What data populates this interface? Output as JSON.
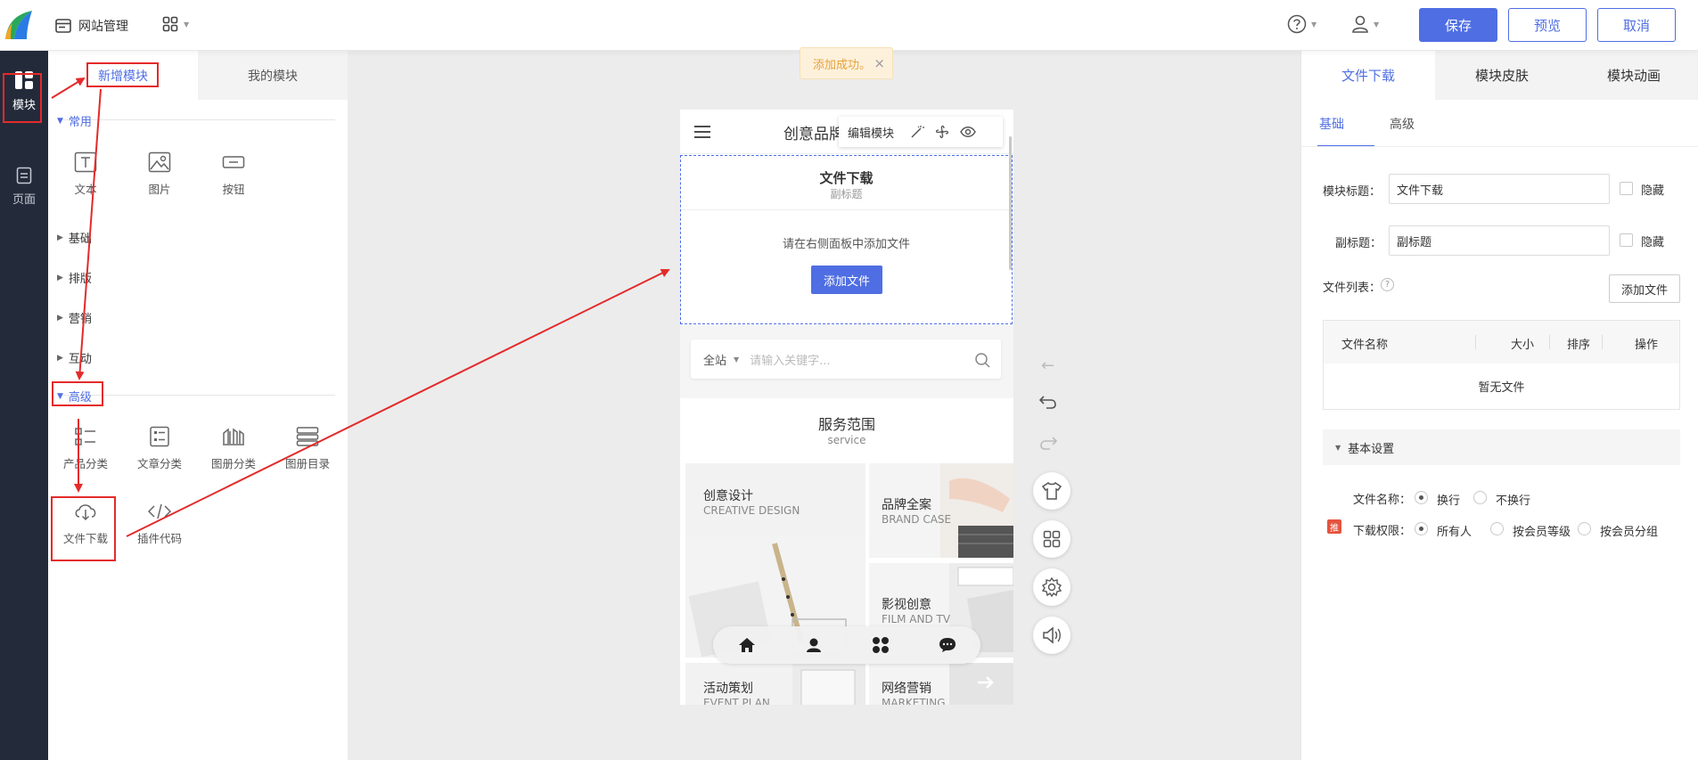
{
  "header": {
    "site_manage": "网站管理",
    "save": "保存",
    "preview": "预览",
    "cancel": "取消"
  },
  "leftnav": {
    "module": "模块",
    "page": "页面"
  },
  "module_panel": {
    "tab_new": "新增模块",
    "tab_mine": "我的模块",
    "group_common": "常用",
    "common_items": [
      "文本",
      "图片",
      "按钮"
    ],
    "group_basic": "基础",
    "group_layout": "排版",
    "group_marketing": "营销",
    "group_interact": "互动",
    "group_advanced": "高级",
    "advanced_items": [
      "产品分类",
      "文章分类",
      "图册分类",
      "图册目录",
      "文件下载",
      "插件代码"
    ]
  },
  "toast": {
    "text": "添加成功。",
    "close": "×"
  },
  "phone": {
    "header_title": "创意品牌",
    "edit_module": "编辑模块",
    "file_module_title": "文件下载",
    "file_module_subtitle": "副标题",
    "empty_hint": "请在右侧面板中添加文件",
    "add_file_btn": "添加文件",
    "search_scope": "全站",
    "search_placeholder": "请输入关键字...",
    "service_title": "服务范围",
    "service_subtitle": "service",
    "services": [
      {
        "cn": "创意设计",
        "en": "CREATIVE DESIGN"
      },
      {
        "cn": "品牌全案",
        "en": "BRAND CASE"
      },
      {
        "cn": "影视创意",
        "en": "FILM AND TV"
      },
      {
        "cn": "活动策划",
        "en": "EVENT PLAN"
      },
      {
        "cn": "网络营销",
        "en": "MARKETING"
      }
    ]
  },
  "right_panel": {
    "tabs": [
      "文件下载",
      "模块皮肤",
      "模块动画"
    ],
    "subtabs": [
      "基础",
      "高级"
    ],
    "title_label": "模块标题：",
    "title_value": "文件下载",
    "hide": "隐藏",
    "subtitle_label": "副标题：",
    "subtitle_value": "副标题",
    "file_list_label": "文件列表：",
    "add_file": "添加文件",
    "table_headers": [
      "文件名称",
      "大小",
      "排序",
      "操作"
    ],
    "empty_table": "暂无文件",
    "basic_settings": "基本设置",
    "filename_label": "文件名称：",
    "filename_options": [
      "换行",
      "不换行"
    ],
    "download_perm_label": "下载权限：",
    "perm_badge": "推",
    "perm_options": [
      "所有人",
      "按会员等级",
      "按会员分组"
    ]
  },
  "colors": {
    "primary": "#4f6ee3",
    "sidebar": "#232b3b",
    "annotation_red": "#e42a2a",
    "toast_bg": "#fdf1dc",
    "toast_text": "#e6a23c"
  }
}
